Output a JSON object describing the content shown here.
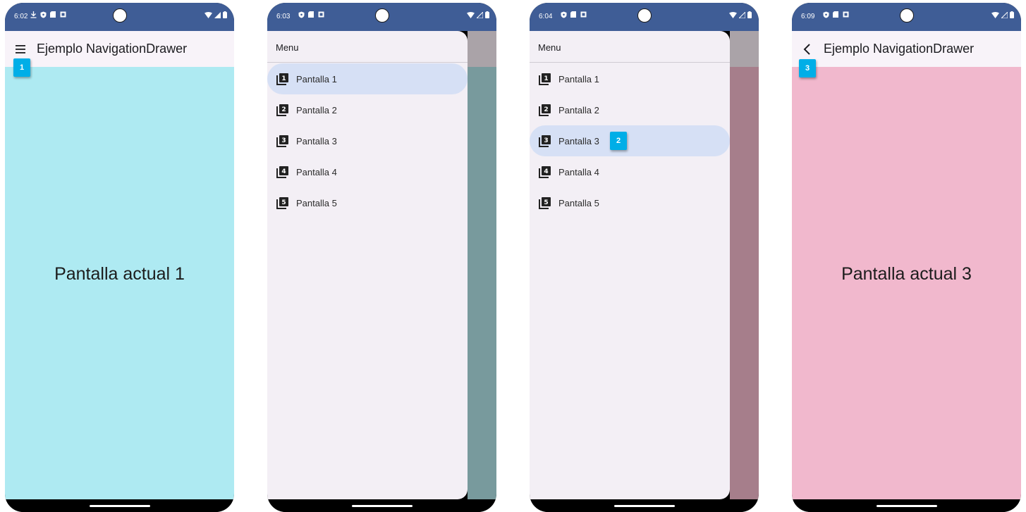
{
  "colors": {
    "status_bar": "#3f5d96",
    "app_bar": "#f8f3f9",
    "screen1_bg": "#aeeaf2",
    "screen3_bg": "#f1b8cd",
    "drawer_bg": "#f3eff5",
    "selected_item": "#d6e0f5",
    "scrim_phone2": "#789a9d",
    "scrim_phone3": "#a67e8b",
    "badge": "#00aee7"
  },
  "phones": [
    {
      "status_time": "6:02",
      "app_title": "Ejemplo NavigationDrawer",
      "nav_icon": "menu-icon",
      "center_text": "Pantalla actual 1",
      "badge": "1"
    },
    {
      "status_time": "6:03",
      "drawer": {
        "header": "Menu",
        "items": [
          {
            "label": "Pantalla 1",
            "icon": "filter-1-icon",
            "selected": true
          },
          {
            "label": "Pantalla 2",
            "icon": "filter-2-icon",
            "selected": false
          },
          {
            "label": "Pantalla 3",
            "icon": "filter-3-icon",
            "selected": false
          },
          {
            "label": "Pantalla 4",
            "icon": "filter-4-icon",
            "selected": false
          },
          {
            "label": "Pantalla 5",
            "icon": "filter-5-icon",
            "selected": false
          }
        ]
      }
    },
    {
      "status_time": "6:04",
      "badge": "2",
      "drawer": {
        "header": "Menu",
        "items": [
          {
            "label": "Pantalla 1",
            "icon": "filter-1-icon",
            "selected": false
          },
          {
            "label": "Pantalla 2",
            "icon": "filter-2-icon",
            "selected": false
          },
          {
            "label": "Pantalla 3",
            "icon": "filter-3-icon",
            "selected": true
          },
          {
            "label": "Pantalla 4",
            "icon": "filter-4-icon",
            "selected": false
          },
          {
            "label": "Pantalla 5",
            "icon": "filter-5-icon",
            "selected": false
          }
        ]
      }
    },
    {
      "status_time": "6:09",
      "app_title": "Ejemplo NavigationDrawer",
      "nav_icon": "back-arrow-icon",
      "center_text": "Pantalla actual 3",
      "badge": "3"
    }
  ]
}
